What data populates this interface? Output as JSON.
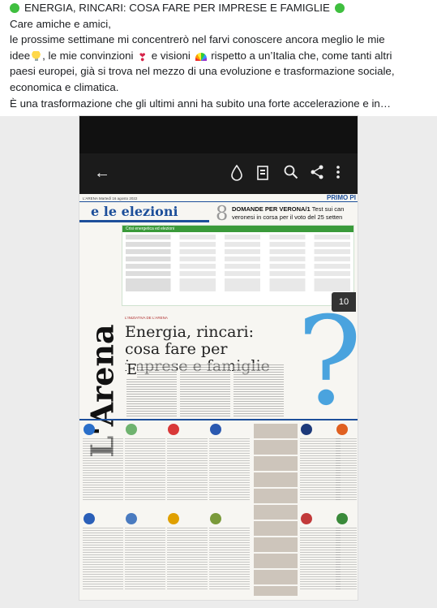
{
  "post": {
    "title": "ENERGIA, RINCARI: COSA FARE PER IMPRESE E FAMIGLIE",
    "greeting": "Care amiche e amici,",
    "line1": "le prossime settimane mi concentrerò nel farvi conoscere ancora meglio le mie",
    "line2a": "idee",
    "line2b": ", le mie convinzioni",
    "line2c": "e visioni",
    "line2d": "rispetto a un’Italia che, come tanti altri",
    "line3": "paesi europei, già si trova nel mezzo di una evoluzione e trasformazione sociale,",
    "line4": "economica e climatica.",
    "line5": "È una trasformazione che gli ultimi anni ha subito una forte accelerazione e in…",
    "icons": [
      "green-circle-icon",
      "light-bulb-icon",
      "heart-icon",
      "rainbow-icon",
      "green-circle-icon"
    ]
  },
  "viewer": {
    "icons": [
      "back-arrow-icon",
      "water-drop-icon",
      "document-icon",
      "search-icon",
      "share-icon",
      "more-vert-icon"
    ]
  },
  "newspaper": {
    "masthead_small": "L'ARENA  Martedì 16 agosto 2022",
    "section_right": "PRIMO PI",
    "section_title": "e le elezioni",
    "number": "8",
    "domande_title": "DOMANDE PER VERONA/1",
    "domande_text": "Test sui can",
    "domande_sub": "veronesi in corsa per il voto del 25 setten",
    "table_title": "Crisi energetica ed elezioni",
    "page_badge": "10",
    "logo": "L'Arena",
    "kicker": "L'INIZIATIVA DE L'ARENA",
    "headline": "Energia, rincari: cosa fare per imprese e famiglie",
    "drop_cap": "E",
    "qmark": "?"
  },
  "colors": {
    "accent_green": "#3fbf3f",
    "newspaper_blue": "#1d4f9a",
    "qmark_blue": "#4aa3de"
  }
}
